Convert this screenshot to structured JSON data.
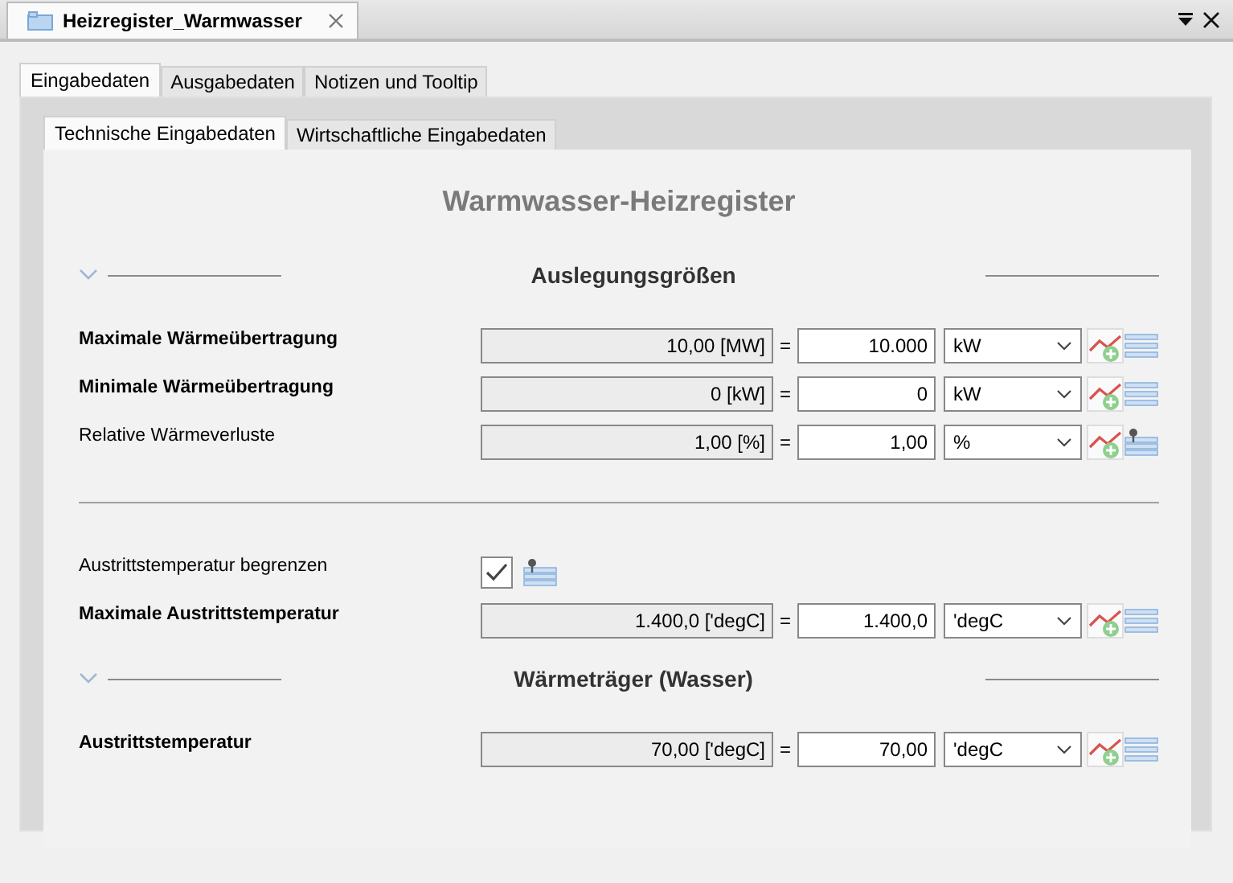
{
  "editor_tab": {
    "title": "Heizregister_Warmwasser",
    "selected": true
  },
  "tabs": [
    {
      "label": "Eingabedaten",
      "selected": true
    },
    {
      "label": "Ausgabedaten",
      "selected": false
    },
    {
      "label": "Notizen und Tooltip",
      "selected": false
    }
  ],
  "subtabs": [
    {
      "label": "Technische Eingabedaten",
      "selected": true
    },
    {
      "label": "Wirtschaftliche Eingabedaten",
      "selected": false
    }
  ],
  "heading": "Warmwasser-Heizregister",
  "items": [
    {
      "kind": "section",
      "title": "Auslegungsgrößen",
      "expanded": true
    },
    {
      "kind": "quantity",
      "label": "Maximale Wärmeübertragung",
      "bold": true,
      "display": "10,00 [MW]",
      "relation": "=",
      "value": "10.000",
      "unit": "kW",
      "pinned": false
    },
    {
      "kind": "quantity",
      "label": "Minimale Wärmeübertragung",
      "bold": true,
      "display": "0 [kW]",
      "relation": "=",
      "value": "0",
      "unit": "kW",
      "pinned": false
    },
    {
      "kind": "quantity",
      "label": "Relative Wärmeverluste",
      "bold": false,
      "display": "1,00 [%]",
      "relation": "=",
      "value": "1,00",
      "unit": "%",
      "pinned": true
    },
    {
      "kind": "divider"
    },
    {
      "kind": "checkbox",
      "label": "Austrittstemperatur begrenzen",
      "bold": false,
      "checked": true,
      "pinned": true
    },
    {
      "kind": "quantity",
      "label": "Maximale Austrittstemperatur",
      "bold": true,
      "display": "1.400,0 ['degC]",
      "relation": "=",
      "value": "1.400,0",
      "unit": "'degC",
      "pinned": false
    },
    {
      "kind": "section",
      "title": "Wärmeträger (Wasser)",
      "expanded": true
    },
    {
      "kind": "quantity",
      "label": "Austrittstemperatur",
      "bold": true,
      "display": "70,00 ['degC]",
      "relation": "=",
      "value": "70,00",
      "unit": "'degC",
      "pinned": false
    }
  ]
}
